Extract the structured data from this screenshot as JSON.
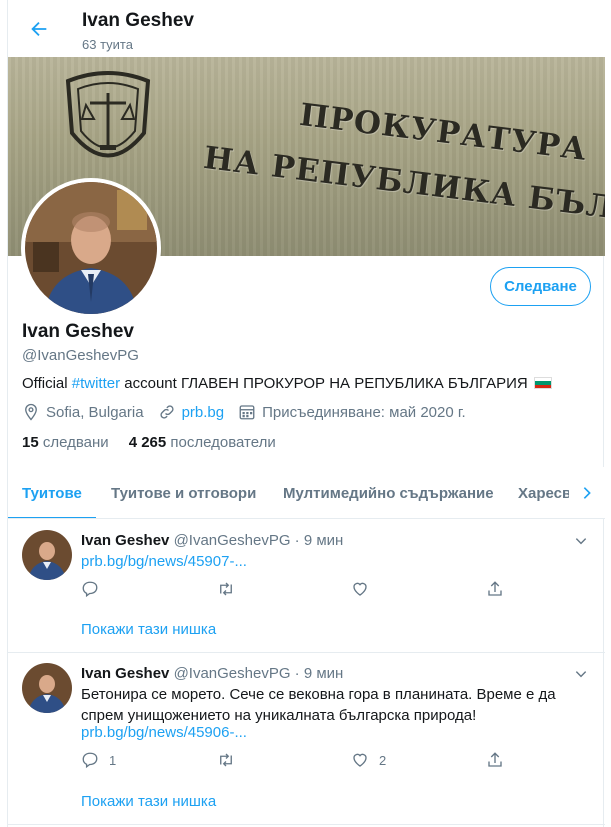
{
  "header": {
    "title": "Ivan Geshev",
    "subtitle": "63 туита"
  },
  "banner": {
    "line1": "ПРОКУРАТУРА",
    "line2": "НА РЕПУБЛИКА БЪЛГАРИЯ",
    "emblem_text": "ПРОКУРАТУРА"
  },
  "profile": {
    "name": "Ivan Geshev",
    "handle": "@IvanGeshevPG",
    "follow_label": "Следване",
    "bio_prefix": "Official ",
    "bio_hashtag": "#twitter",
    "bio_suffix": " account ГЛАВЕН ПРОКУРОР НА РЕПУБЛИКА БЪЛГАРИЯ",
    "location": "Sofia, Bulgaria",
    "website": "prb.bg",
    "joined": "Присъединяване: май 2020 г.",
    "following_count": "15",
    "following_label": "следвани",
    "followers_count": "4 265",
    "followers_label": "последователи"
  },
  "tabs": [
    {
      "label": "Туитове",
      "active": true
    },
    {
      "label": "Туитове и отговори",
      "active": false
    },
    {
      "label": "Мултимедийно съдържание",
      "active": false
    },
    {
      "label": "Харесвания",
      "active": false
    }
  ],
  "tweets": [
    {
      "author": "Ivan Geshev",
      "meta": "@IvanGeshevPG · 9 мин",
      "text": "",
      "link": "prb.bg/bg/news/45907-...",
      "reply_count": "",
      "retweet_count": "",
      "like_count": "",
      "thread_label": "Покажи тази нишка"
    },
    {
      "author": "Ivan Geshev",
      "meta": "@IvanGeshevPG · 9 мин",
      "text": "Бетонира се морето. Сече се вековна гора в планината. Време е да спрем унищожението на уникалната българска природа!",
      "link": "prb.bg/bg/news/45906-...",
      "reply_count": "1",
      "retweet_count": "",
      "like_count": "2",
      "thread_label": "Покажи тази нишка"
    }
  ],
  "colors": {
    "accent": "#1da1f2",
    "text": "#14171a",
    "muted": "#657786",
    "border": "#e6ecf0"
  }
}
